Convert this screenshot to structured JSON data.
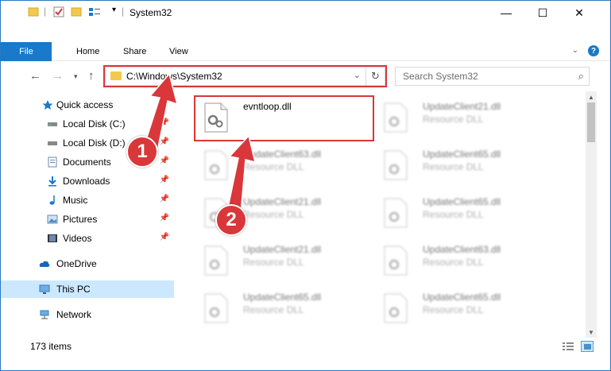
{
  "window": {
    "title": "System32",
    "controls": {
      "minimize": "—",
      "maximize": "☐",
      "close": "✕"
    }
  },
  "ribbon": {
    "tabs": [
      "File",
      "Home",
      "Share",
      "View"
    ],
    "help": "?"
  },
  "address": {
    "path": "C:\\Windows\\System32",
    "chevron": "⌄",
    "refresh": "↻"
  },
  "search": {
    "placeholder": "Search System32"
  },
  "nav": {
    "items": [
      {
        "label": "Quick access",
        "icon": "star-icon"
      },
      {
        "label": "Local Disk (C:)",
        "icon": "drive-icon",
        "pinned": true
      },
      {
        "label": "Local Disk (D:)",
        "icon": "drive-icon",
        "pinned": true
      },
      {
        "label": "Documents",
        "icon": "documents-icon",
        "pinned": true
      },
      {
        "label": "Downloads",
        "icon": "download-icon",
        "pinned": true
      },
      {
        "label": "Music",
        "icon": "music-icon",
        "pinned": true
      },
      {
        "label": "Pictures",
        "icon": "pictures-icon",
        "pinned": true
      },
      {
        "label": "Videos",
        "icon": "videos-icon",
        "pinned": true
      },
      {
        "label": "OneDrive",
        "icon": "cloud-icon"
      },
      {
        "label": "This PC",
        "icon": "computer-icon",
        "selected": true
      },
      {
        "label": "Network",
        "icon": "network-icon"
      }
    ]
  },
  "files": [
    {
      "name": "evntloop.dll",
      "type": ""
    },
    {
      "name": "UpdateClient21.dll",
      "type": "Resource DLL"
    },
    {
      "name": "UpdateClient63.dll",
      "type": "Resource DLL"
    },
    {
      "name": "UpdateClient65.dll",
      "type": "Resource DLL"
    },
    {
      "name": "UpdateClient21.dll",
      "type": "Resource DLL"
    },
    {
      "name": "UpdateClient65.dll",
      "type": "Resource DLL"
    },
    {
      "name": "UpdateClient21.dll",
      "type": "Resource DLL"
    },
    {
      "name": "UpdateClient63.dll",
      "type": "Resource DLL"
    },
    {
      "name": "UpdateClient65.dll",
      "type": "Resource DLL"
    },
    {
      "name": "UpdateClient65.dll",
      "type": "Resource DLL"
    }
  ],
  "status": {
    "item_count": "173 items"
  },
  "callouts": [
    "1",
    "2"
  ],
  "colors": {
    "accent": "#1979ca",
    "highlight": "#d9373a",
    "selected": "#cce8ff"
  }
}
